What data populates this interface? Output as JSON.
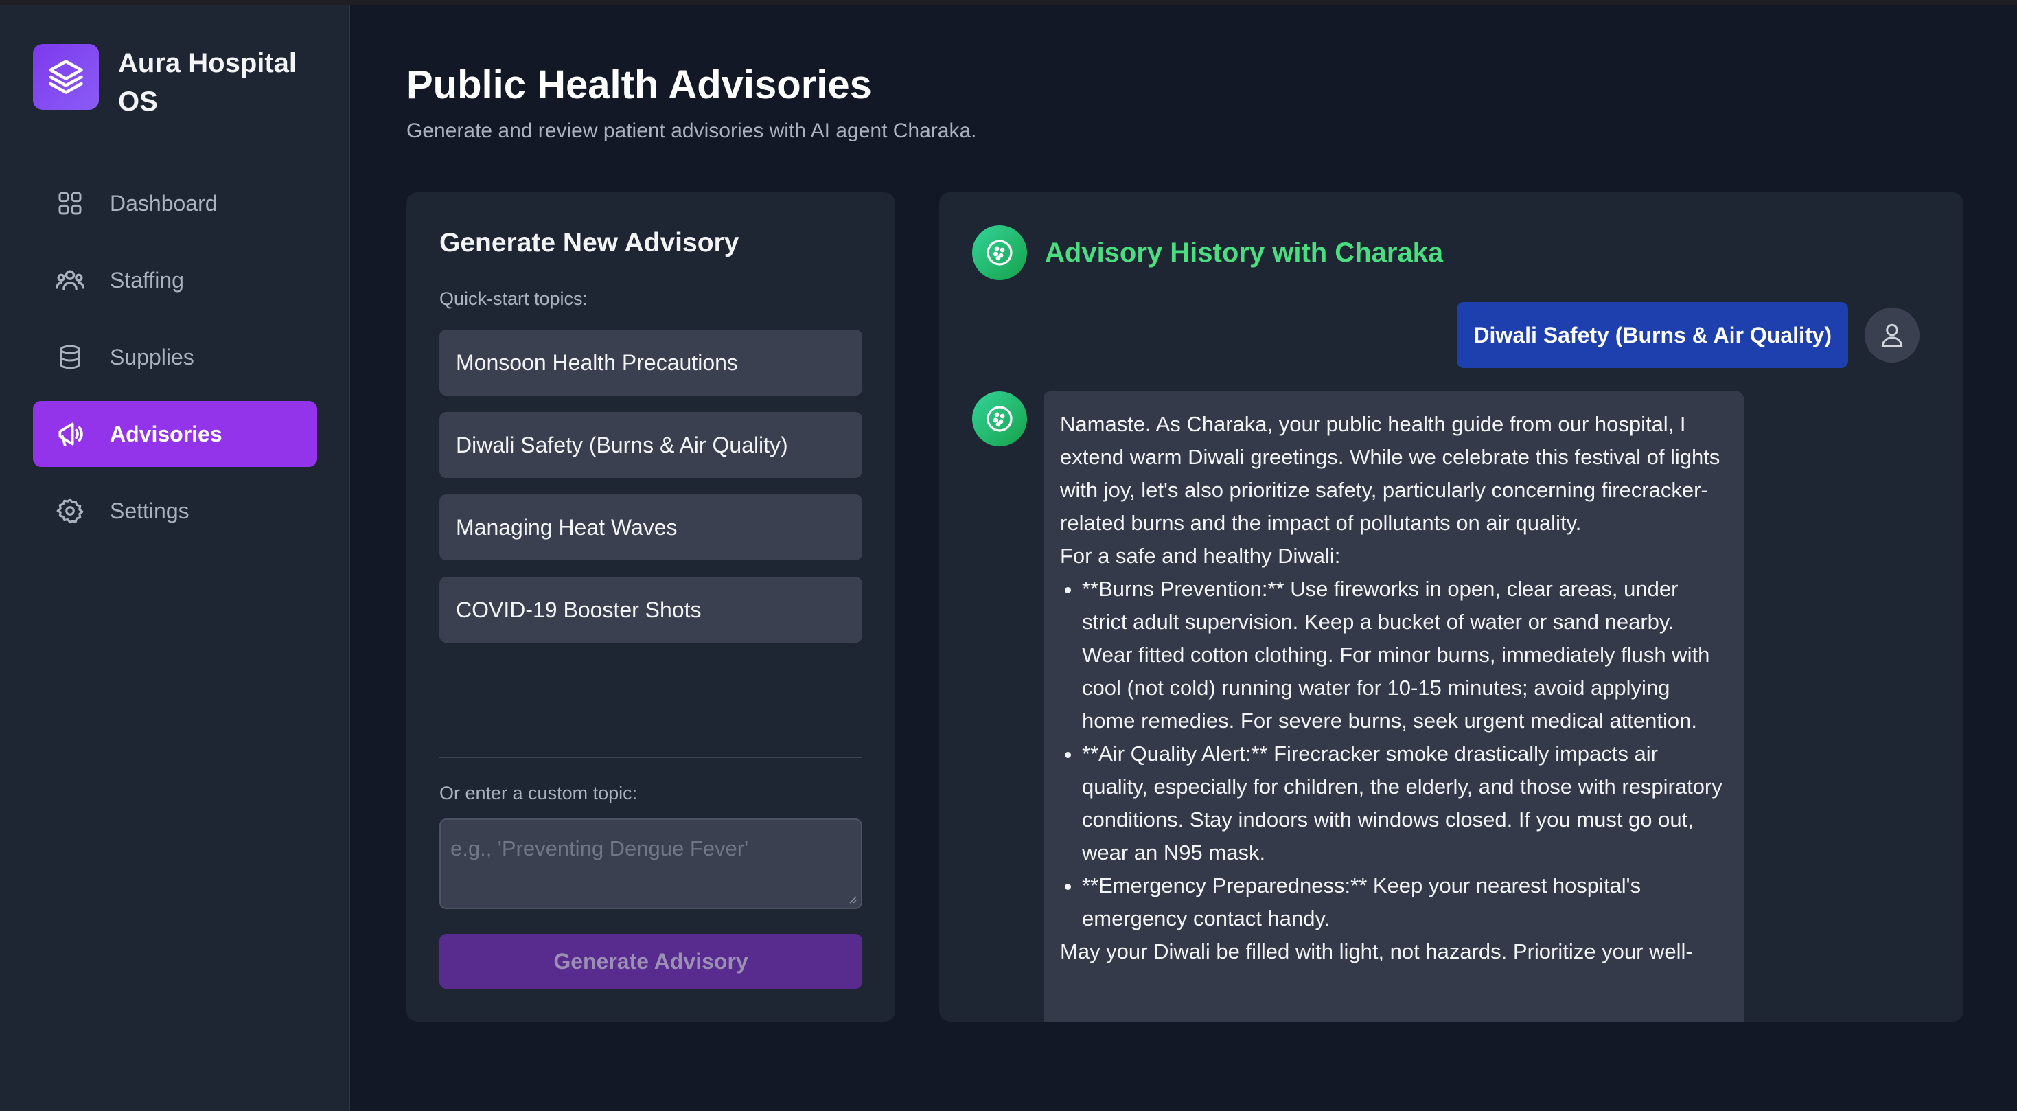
{
  "app": {
    "name": "Aura Hospital OS"
  },
  "sidebar": {
    "items": [
      {
        "label": "Dashboard",
        "icon": "grid-icon",
        "active": false
      },
      {
        "label": "Staffing",
        "icon": "users-icon",
        "active": false
      },
      {
        "label": "Supplies",
        "icon": "database-icon",
        "active": false
      },
      {
        "label": "Advisories",
        "icon": "megaphone-icon",
        "active": true
      },
      {
        "label": "Settings",
        "icon": "gear-icon",
        "active": false
      }
    ]
  },
  "header": {
    "title": "Public Health Advisories",
    "subtitle": "Generate and review patient advisories with AI agent Charaka."
  },
  "generator": {
    "title": "Generate New Advisory",
    "quick_label": "Quick-start topics:",
    "topics": [
      "Monsoon Health Precautions",
      "Diwali Safety (Burns & Air Quality)",
      "Managing Heat Waves",
      "COVID-19 Booster Shots"
    ],
    "custom_label": "Or enter a custom topic:",
    "custom_placeholder": "e.g., 'Preventing Dengue Fever'",
    "button_label": "Generate Advisory"
  },
  "history": {
    "title": "Advisory History with Charaka",
    "user_message": "Diwali Safety (Burns & Air Quality)",
    "bot_intro": "Namaste. As Charaka, your public health guide from our hospital, I extend warm Diwali greetings. While we celebrate this festival of lights with joy, let's also prioritize safety, particularly concerning firecracker-related burns and the impact of pollutants on air quality.",
    "bot_lead": "For a safe and healthy Diwali:",
    "bot_points": [
      "**Burns Prevention:** Use fireworks in open, clear areas, under strict adult supervision. Keep a bucket of water or sand nearby. Wear fitted cotton clothing. For minor burns, immediately flush with cool (not cold) running water for 10-15 minutes; avoid applying home remedies. For severe burns, seek urgent medical attention.",
      "**Air Quality Alert:** Firecracker smoke drastically impacts air quality, especially for children, the elderly, and those with respiratory conditions. Stay indoors with windows closed. If you must go out, wear an N95 mask.",
      "**Emergency Preparedness:** Keep your nearest hospital's emergency contact handy."
    ],
    "bot_closing": "May your Diwali be filled with light, not hazards. Prioritize your well-"
  },
  "colors": {
    "accent": "#9333ea",
    "user_bubble": "#1e40af",
    "bot_title": "#4ade80",
    "background": "#121826",
    "card": "#1e2533"
  }
}
